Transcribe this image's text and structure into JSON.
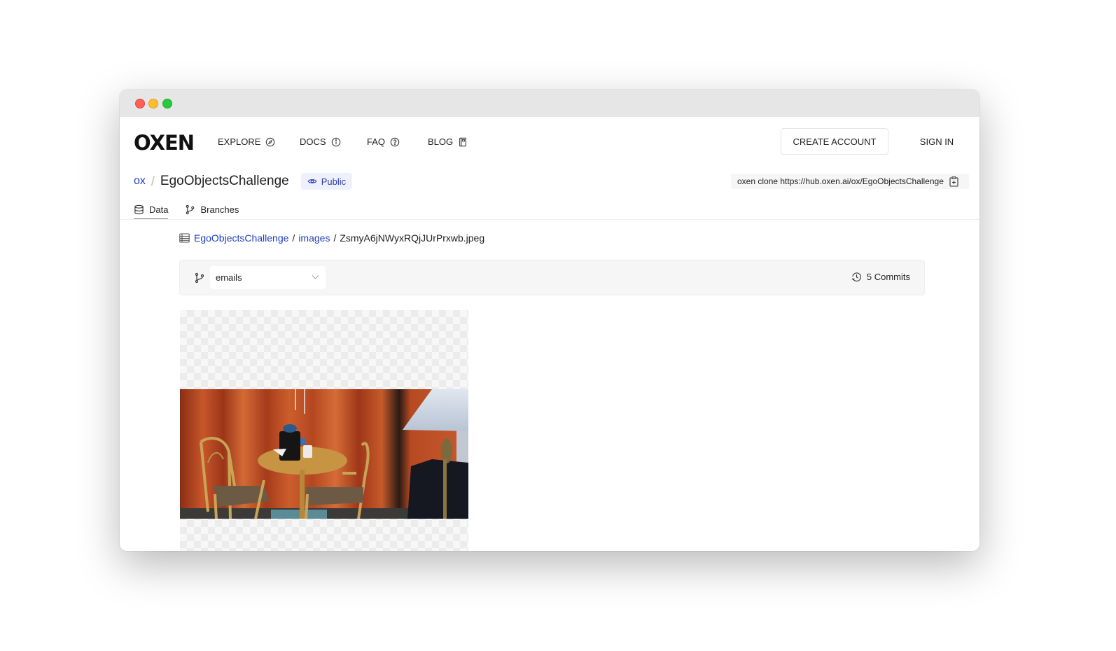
{
  "window": {
    "controls": [
      "close",
      "minimize",
      "maximize"
    ]
  },
  "navbar": {
    "logo": "OXEN",
    "items": [
      {
        "label": "EXPLORE",
        "icon": "compass-icon"
      },
      {
        "label": "DOCS",
        "icon": "info-icon"
      },
      {
        "label": "FAQ",
        "icon": "question-icon"
      },
      {
        "label": "BLOG",
        "icon": "book-icon"
      }
    ],
    "create_account_label": "CREATE ACCOUNT",
    "sign_in_label": "SIGN IN"
  },
  "repo": {
    "owner": "ox",
    "separator": "/",
    "name": "EgoObjectsChallenge",
    "visibility": "Public",
    "clone_command": "oxen clone https://hub.oxen.ai/ox/EgoObjectsChallenge"
  },
  "tabs": [
    {
      "label": "Data",
      "icon": "database-icon",
      "active": true
    },
    {
      "label": "Branches",
      "icon": "branch-icon",
      "active": false
    }
  ],
  "file_path": {
    "root": "EgoObjectsChallenge",
    "folder": "images",
    "file": "ZsmyA6jNWyxRQjJUrPrxwb.jpeg",
    "separator": "/"
  },
  "toolbar": {
    "branch": "emails",
    "commits_label": "5 Commits"
  },
  "image": {
    "alt": "Room with orange curtains, round wooden table with coffee maker, two chairs, and floor lamp"
  }
}
